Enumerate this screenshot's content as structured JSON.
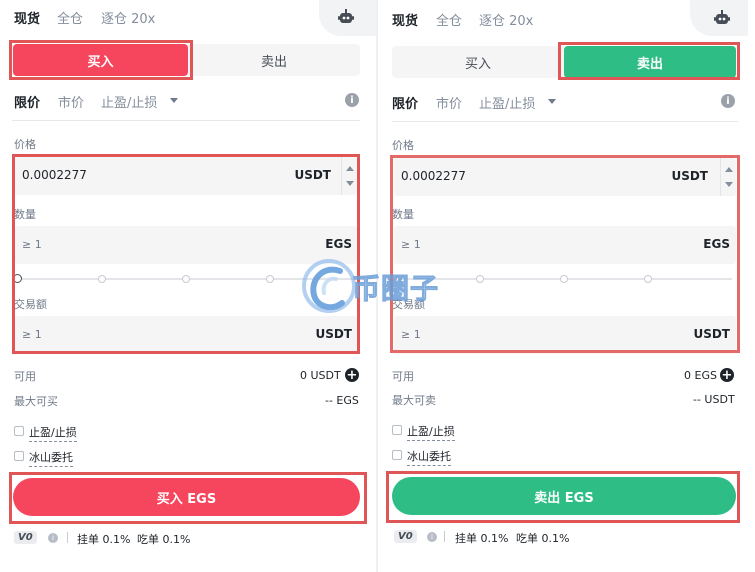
{
  "buy_panel": {
    "tabs": [
      "现货",
      "全仓",
      "逐仓 20x"
    ],
    "side_buttons": {
      "buy": "买入",
      "sell": "卖出",
      "active": "buy"
    },
    "order_types": [
      "限价",
      "市价",
      "止盈/止损"
    ],
    "price": {
      "label": "价格",
      "value": "0.0002277",
      "unit": "USDT"
    },
    "amount": {
      "label": "数量",
      "placeholder": "≥ 1",
      "unit": "EGS"
    },
    "total": {
      "label": "交易额",
      "placeholder": "≥ 1",
      "unit": "USDT"
    },
    "available": {
      "label": "可用",
      "value": "0 USDT"
    },
    "max": {
      "label": "最大可买",
      "value": "-- EGS"
    },
    "options": [
      "止盈/止损",
      "冰山委托"
    ],
    "submit_label": "买入 EGS",
    "vip": "V0",
    "maker_fee": "挂单 0.1%",
    "taker_fee": "吃单 0.1%"
  },
  "sell_panel": {
    "tabs": [
      "现货",
      "全仓",
      "逐仓 20x"
    ],
    "side_buttons": {
      "buy": "买入",
      "sell": "卖出",
      "active": "sell"
    },
    "order_types": [
      "限价",
      "市价",
      "止盈/止损"
    ],
    "price": {
      "label": "价格",
      "value": "0.0002277",
      "unit": "USDT"
    },
    "amount": {
      "label": "数量",
      "placeholder": "≥ 1",
      "unit": "EGS"
    },
    "total": {
      "label": "交易额",
      "placeholder": "≥ 1",
      "unit": "USDT"
    },
    "available": {
      "label": "可用",
      "value": "0 EGS"
    },
    "max": {
      "label": "最大可卖",
      "value": "-- USDT"
    },
    "options": [
      "止盈/止损",
      "冰山委托"
    ],
    "submit_label": "卖出 EGS",
    "vip": "V0",
    "maker_fee": "挂单 0.1%",
    "taker_fee": "吃单 0.1%"
  },
  "watermark": {
    "text": "币圈子"
  },
  "colors": {
    "buy": "#f6465d",
    "sell": "#2ebd85",
    "highlight": "#e05656"
  },
  "icons": [
    "robot-icon",
    "info-icon",
    "plus-circle-icon",
    "checkbox-icon",
    "caret-down-icon"
  ]
}
